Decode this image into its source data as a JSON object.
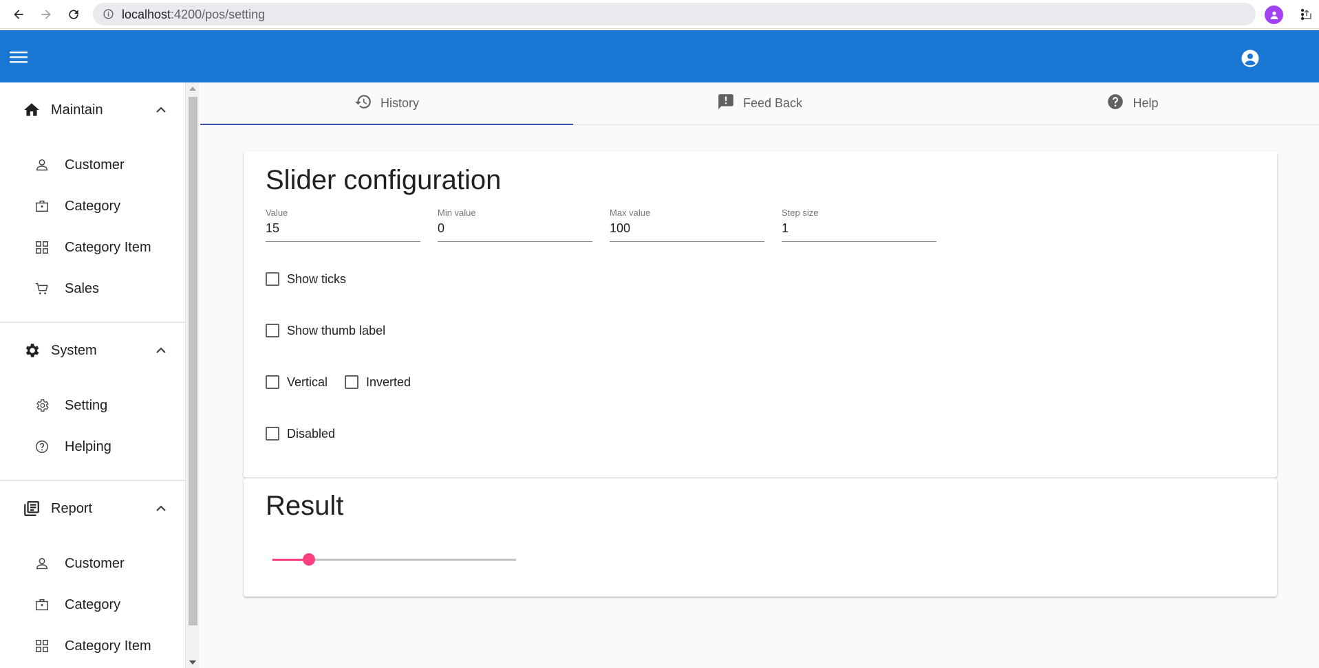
{
  "browser": {
    "url_host": "localhost",
    "url_path": ":4200/pos/setting"
  },
  "sidebar": {
    "sections": [
      {
        "label": "Maintain",
        "icon": "home-icon",
        "items": [
          {
            "label": "Customer",
            "icon": "person-icon"
          },
          {
            "label": "Category",
            "icon": "briefcase-icon"
          },
          {
            "label": "Category Item",
            "icon": "grid-icon"
          },
          {
            "label": "Sales",
            "icon": "cart-icon"
          }
        ]
      },
      {
        "label": "System",
        "icon": "gear-icon",
        "items": [
          {
            "label": "Setting",
            "icon": "gear-outline-icon"
          },
          {
            "label": "Helping",
            "icon": "help-circle-icon"
          }
        ]
      },
      {
        "label": "Report",
        "icon": "library-books-icon",
        "items": [
          {
            "label": "Customer",
            "icon": "person-icon"
          },
          {
            "label": "Category",
            "icon": "briefcase-icon"
          },
          {
            "label": "Category Item",
            "icon": "grid-icon"
          }
        ]
      }
    ]
  },
  "tabs": [
    {
      "label": "History",
      "icon": "history-icon",
      "active": true
    },
    {
      "label": "Feed Back",
      "icon": "feedback-icon",
      "active": false
    },
    {
      "label": "Help",
      "icon": "help-icon",
      "active": false
    }
  ],
  "config": {
    "title": "Slider configuration",
    "fields": {
      "value": {
        "label": "Value",
        "value": "15"
      },
      "min": {
        "label": "Min value",
        "value": "0"
      },
      "max": {
        "label": "Max value",
        "value": "100"
      },
      "step": {
        "label": "Step size",
        "value": "1"
      }
    },
    "checkboxes": {
      "show_ticks": {
        "label": "Show ticks",
        "checked": false
      },
      "show_thumb_label": {
        "label": "Show thumb label",
        "checked": false
      },
      "vertical": {
        "label": "Vertical",
        "checked": false
      },
      "inverted": {
        "label": "Inverted",
        "checked": false
      },
      "disabled": {
        "label": "Disabled",
        "checked": false
      }
    }
  },
  "result": {
    "title": "Result",
    "slider": {
      "value": 15,
      "min": 0,
      "max": 100
    }
  },
  "colors": {
    "toolbar": "#1976d2",
    "accent": "#ff4081",
    "tab_ink": "#3f51b5"
  }
}
